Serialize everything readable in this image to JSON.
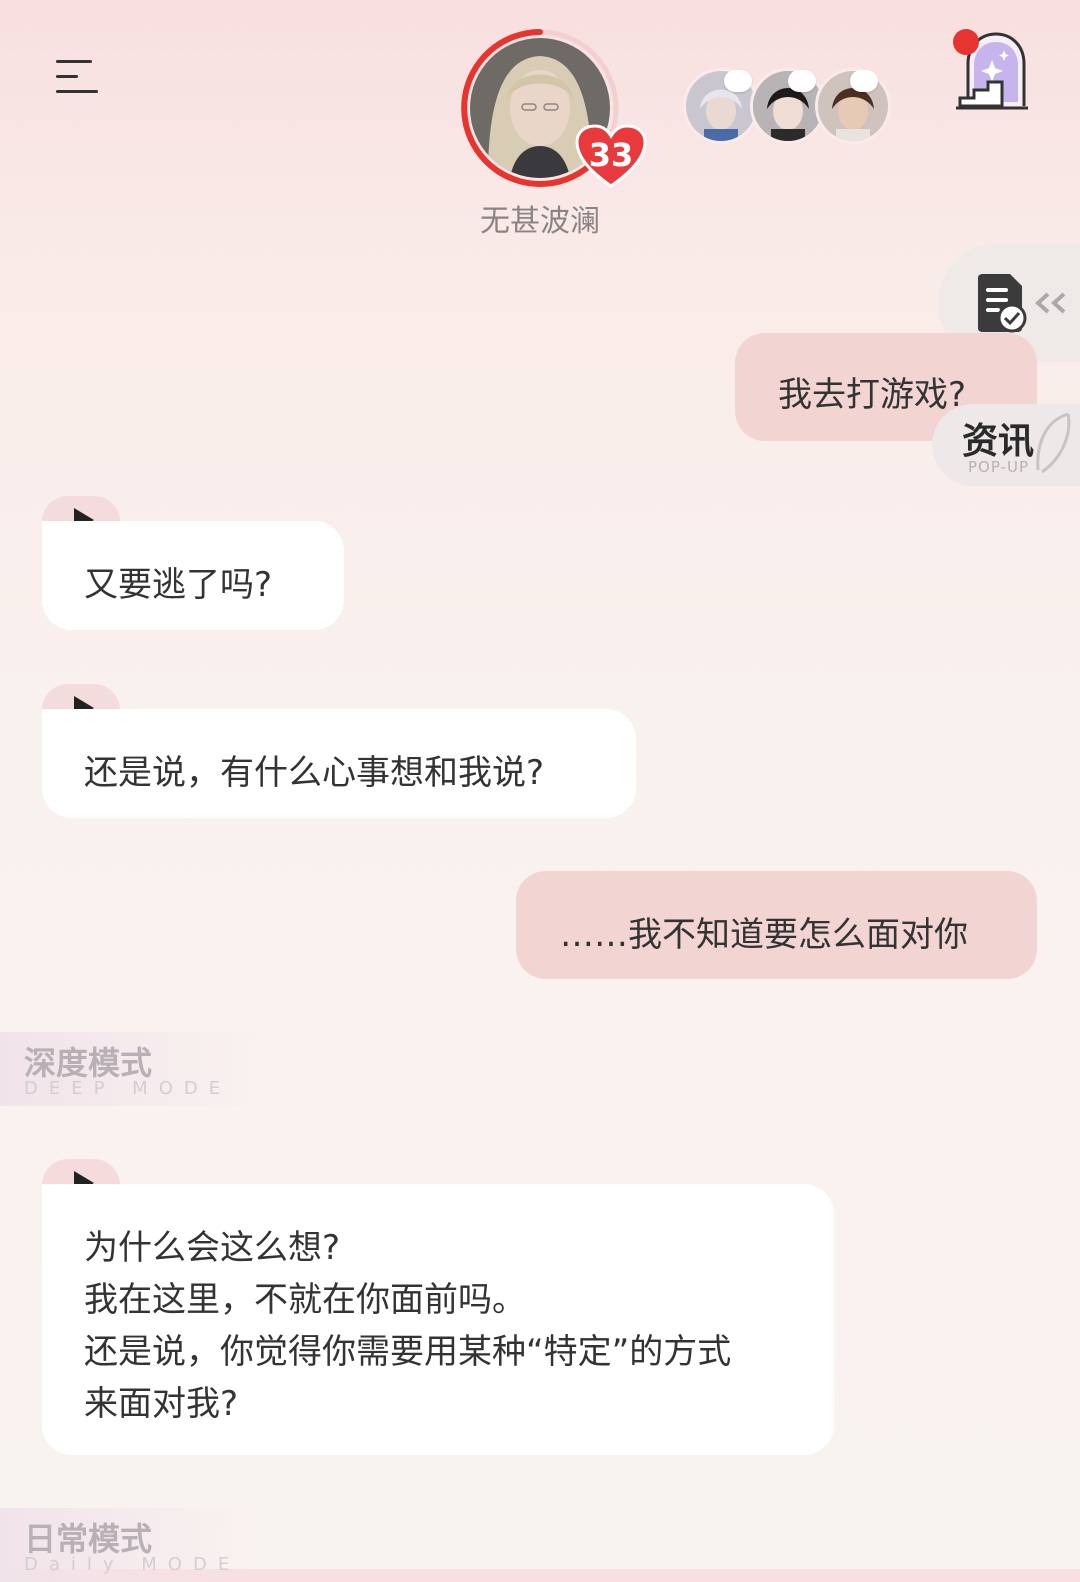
{
  "header": {
    "character_name": "无甚波澜",
    "affinity_level": "33",
    "menu_icon": "menu-icon",
    "portal_icon": "sparkle-door-icon"
  },
  "colors": {
    "accent_red": "#e8342f",
    "bubble_me": "#f2d4d3",
    "bubble_ai": "#ffffff"
  },
  "side_widgets": {
    "popup_title": "资讯",
    "popup_sub": "POP-UP",
    "doc_icon": "document-check-icon"
  },
  "messages": [
    {
      "from": "me",
      "text": "我去打游戏?"
    },
    {
      "from": "ai",
      "text": "又要逃了吗?"
    },
    {
      "from": "ai",
      "text": "还是说，有什么心事想和我说?"
    },
    {
      "from": "me",
      "text": "……我不知道要怎么面对你"
    },
    {
      "from": "ai",
      "lines": [
        "为什么会这么想?",
        "我在这里，不就在你面前吗。",
        "还是说，你觉得你需要用某种“特定”的方式",
        "来面对我?"
      ]
    }
  ],
  "modes": {
    "deep_title": "深度模式",
    "deep_sub": "DEEP MODE",
    "daily_title": "日常模式",
    "daily_sub": "Daily MODE"
  }
}
